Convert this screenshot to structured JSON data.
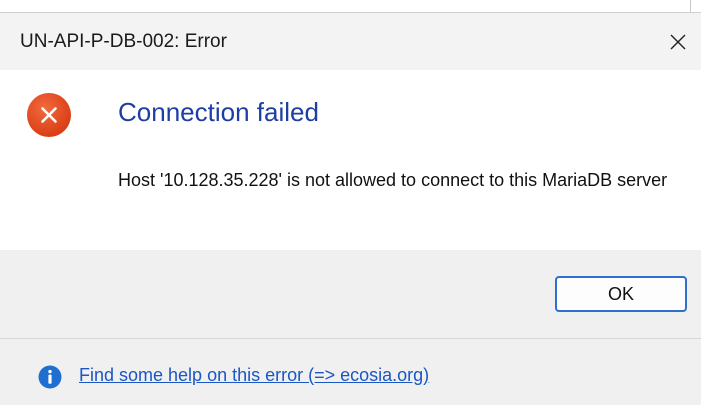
{
  "window": {
    "title": "UN-API-P-DB-002: Error",
    "close_icon": "close-icon"
  },
  "content": {
    "icon": "error-icon",
    "icon_color": "#e8481c",
    "main_instruction": "Connection failed",
    "main_instruction_color": "#1f3ea3",
    "message": "Host '10.128.35.228' is not allowed to connect to this MariaDB server"
  },
  "buttons": {
    "ok_label": "OK",
    "accent_color": "#2e6fcf"
  },
  "footer": {
    "icon": "info-icon",
    "icon_color": "#1f6fd1",
    "help_link": "Find some help on this error (=> ecosia.org)"
  }
}
